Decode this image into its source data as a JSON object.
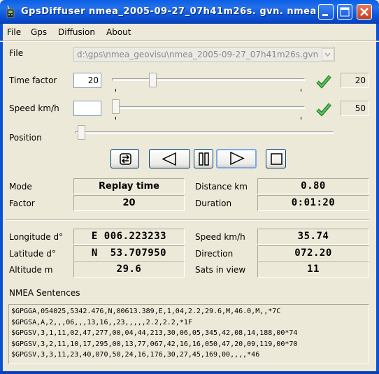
{
  "window": {
    "title": "GpsDiffuser   nmea_2005-09-27_07h41m26s. gvn. nmea"
  },
  "menu": {
    "file": "File",
    "gps": "Gps",
    "diffusion": "Diffusion",
    "about": "About"
  },
  "file": {
    "label": "File",
    "value": "d:\\gps\\nmea_geovisu\\nmea_2005-09-27_07h41m26s.gvn."
  },
  "time_factor": {
    "label": "Time factor",
    "input_value": "20",
    "readout": "20",
    "slider_level": 20
  },
  "speed": {
    "label": "Speed km/h",
    "input_value": "",
    "readout": "50",
    "slider_level": 0
  },
  "position": {
    "label": "Position",
    "slider_level": 0
  },
  "status": {
    "mode_label": "Mode",
    "mode_value": "Replay time",
    "factor_label": "Factor",
    "factor_value": "20",
    "distance_label": "Distance km",
    "distance_value": "0.80",
    "duration_label": "Duration",
    "duration_value": "0:01:20"
  },
  "gps": {
    "longitude_label": "Longitude d°",
    "longitude_value": "E 006.223233",
    "latitude_label": "Latitude d°",
    "latitude_value": "N  53.707950",
    "altitude_label": "Altitude m",
    "altitude_value": "29.6",
    "speed_label": "Speed km/h",
    "speed_value": "35.74",
    "direction_label": "Direction",
    "direction_value": "072.20",
    "sats_label": "Sats in view",
    "sats_value": "11"
  },
  "nmea": {
    "label": "NMEA Sentences",
    "lines": [
      "$GPGGA,054025,5342.476,N,00613.389,E,1,04,2.2,29.6,M,46.0,M,,*7C",
      "$GPGSA,A,2,,,06,,,13,16,,23,,,,,2.2,2.2,*1F",
      "$GPGSV,3,1,11,02,47,277,00,04,44,213,30,06,05,345,42,08,14,188,00*74",
      "$GPGSV,3,2,11,10,17,295,00,13,77,067,42,16,16,050,47,20,09,119,00*70",
      "$GPGSV,3,3,11,23,40,070,50,24,16,176,30,27,45,169,00,,,,*46"
    ]
  },
  "colors": {
    "title_bar": "#0b52d6",
    "window_bg": "#ece9d8",
    "check_green": "#2f9a2f",
    "close_red": "#d2502c"
  }
}
